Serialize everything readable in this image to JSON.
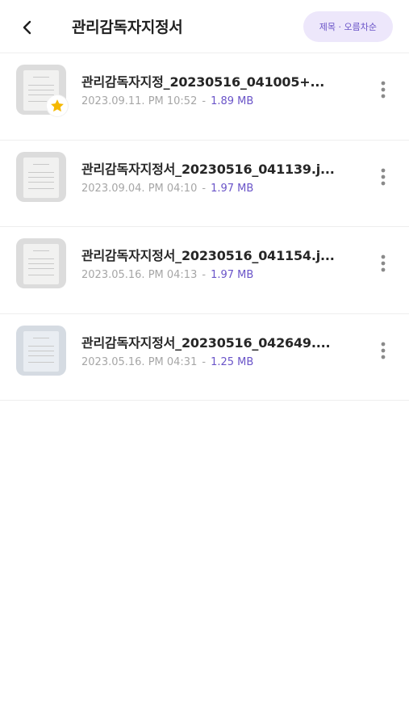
{
  "header": {
    "back_icon": "chevron-left-icon",
    "title": "관리감독자지정서",
    "sort_label": "제목 · 오름차순"
  },
  "files": [
    {
      "name": "관리감독자지정_20230516_041005+...",
      "date": "2023.09.11. PM 10:52",
      "separator": "-",
      "size": "1.89 MB",
      "favorite": true
    },
    {
      "name": "관리감독자지정서_20230516_041139.j...",
      "date": "2023.09.04. PM 04:10",
      "separator": "-",
      "size": "1.97 MB",
      "favorite": false
    },
    {
      "name": "관리감독자지정서_20230516_041154.j...",
      "date": "2023.05.16. PM 04:13",
      "separator": "-",
      "size": "1.97 MB",
      "favorite": false
    },
    {
      "name": "관리감독자지정서_20230516_042649....",
      "date": "2023.05.16. PM 04:31",
      "separator": "-",
      "size": "1.25 MB",
      "favorite": false
    }
  ],
  "colors": {
    "accent": "#6a54c8",
    "pill_bg": "#ede7fb",
    "star": "#f5b800",
    "muted": "#a6a6a6"
  }
}
